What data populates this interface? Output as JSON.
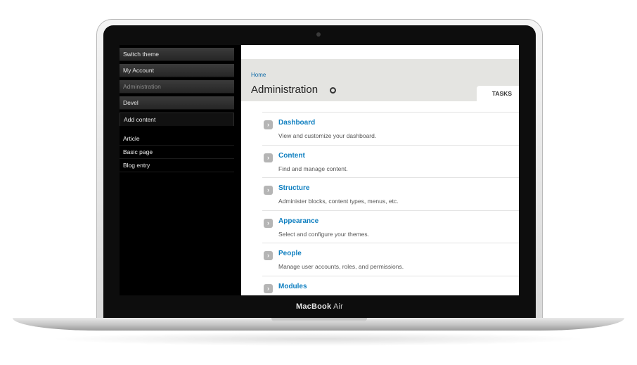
{
  "device": {
    "label_brand": "MacBook",
    "label_model": "Air"
  },
  "sidebar": {
    "buttons": [
      {
        "label": "Switch theme"
      },
      {
        "label": "My Account"
      },
      {
        "label": "Administration"
      },
      {
        "label": "Devel"
      },
      {
        "label": "Add content"
      }
    ],
    "links": [
      {
        "label": "Article"
      },
      {
        "label": "Basic page"
      },
      {
        "label": "Blog entry"
      }
    ]
  },
  "header": {
    "breadcrumb": "Home",
    "title": "Administration",
    "tasks_tab": "TASKS"
  },
  "admin_items": [
    {
      "title": "Dashboard",
      "description": "View and customize your dashboard."
    },
    {
      "title": "Content",
      "description": "Find and manage content."
    },
    {
      "title": "Structure",
      "description": "Administer blocks, content types, menus, etc."
    },
    {
      "title": "Appearance",
      "description": "Select and configure your themes."
    },
    {
      "title": "People",
      "description": "Manage user accounts, roles, and permissions."
    },
    {
      "title": "Modules",
      "description": ""
    }
  ],
  "icons": {
    "item_arrow": "chevron-right-icon",
    "title_action": "gear-icon",
    "camera": "camera-icon"
  }
}
